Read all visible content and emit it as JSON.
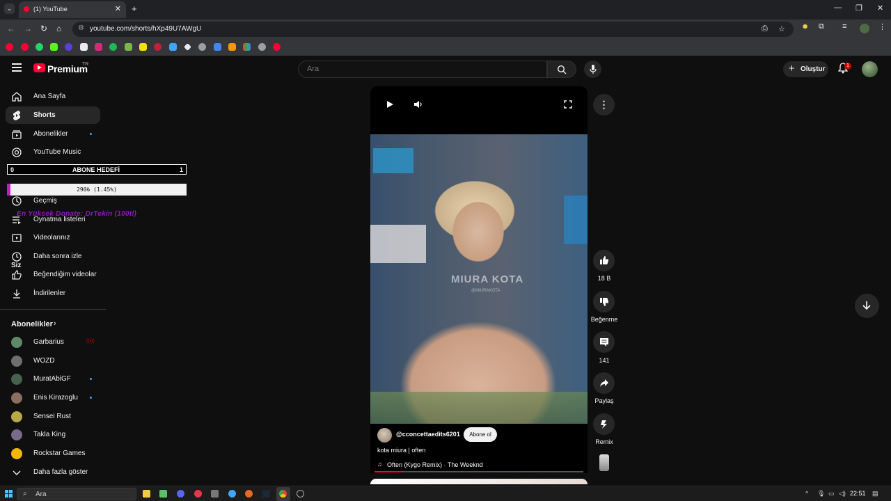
{
  "browser": {
    "tab_title": "(1) YouTube",
    "url": "youtube.com/shorts/hXp49U7AWgU",
    "new_tab": "+",
    "close_tab": "✕"
  },
  "header": {
    "logo_text": "Premium",
    "logo_region": "TR",
    "search_placeholder": "Ara",
    "create_label": "Oluştur",
    "notification_count": "1"
  },
  "sidebar": {
    "main_items": [
      {
        "label": "Ana Sayfa",
        "icon": "home-icon"
      },
      {
        "label": "Shorts",
        "icon": "shorts-icon",
        "active": true
      },
      {
        "label": "Abonelikler",
        "icon": "subscriptions-icon",
        "dot": true
      },
      {
        "label": "YouTube Music",
        "icon": "music-icon"
      }
    ],
    "you_section_label": "Siz",
    "you_items": [
      {
        "label": "Geçmiş",
        "icon": "history-icon"
      },
      {
        "label": "Oynatma listeleri",
        "icon": "playlists-icon"
      },
      {
        "label": "Videolarınız",
        "icon": "your-videos-icon"
      },
      {
        "label": "Daha sonra izle",
        "icon": "watch-later-icon"
      },
      {
        "label": "Beğendiğim videolar",
        "icon": "liked-icon"
      },
      {
        "label": "İndirilenler",
        "icon": "downloads-icon"
      }
    ],
    "subscriptions_heading": "Abonelikler",
    "channels": [
      {
        "label": "Garbarius",
        "color": "#5f8a6a",
        "live": true
      },
      {
        "label": "WOZD",
        "color": "#6f6f6f"
      },
      {
        "label": "MuratAbiGF",
        "color": "#45624f",
        "dot": true
      },
      {
        "label": "Enis Kirazoglu",
        "color": "#8a6f5e",
        "dot": true
      },
      {
        "label": "Sensei Rust",
        "color": "#b8a84a"
      },
      {
        "label": "Takla King",
        "color": "#7a6a8a"
      },
      {
        "label": "Rockstar Games",
        "color": "#f2b705"
      }
    ],
    "show_more": "Daha fazla göster"
  },
  "overlay": {
    "goal_start": "0",
    "goal_title": "ABONE HEDEFİ",
    "goal_end": "1",
    "progress_text": "290₺ (1.45%)",
    "progress_fraction": 0.0145,
    "top_donate": "En Yüksek Donate: DrTekin (100tl)"
  },
  "short": {
    "overlay_text": "MIURA KOTA",
    "overlay_sub": "@MIURAKOTA",
    "channel_handle": "@cconcettaedits6201",
    "subscribe_label": "Abone ol",
    "title": "kota miura | often",
    "sound": "Often (Kygo Remix) · The Weeknd",
    "progress_fraction": 0.13
  },
  "actions": {
    "likes": "18 B",
    "dislike_label": "Beğenme",
    "comments": "141",
    "share_label": "Paylaş",
    "remix_label": "Remix"
  },
  "taskbar": {
    "search_placeholder": "Ara",
    "time": "22:51"
  },
  "colors": {
    "yt_red": "#ff0033",
    "accent_blue": "#3ea6ff",
    "donate_purple": "#8f17c3"
  }
}
